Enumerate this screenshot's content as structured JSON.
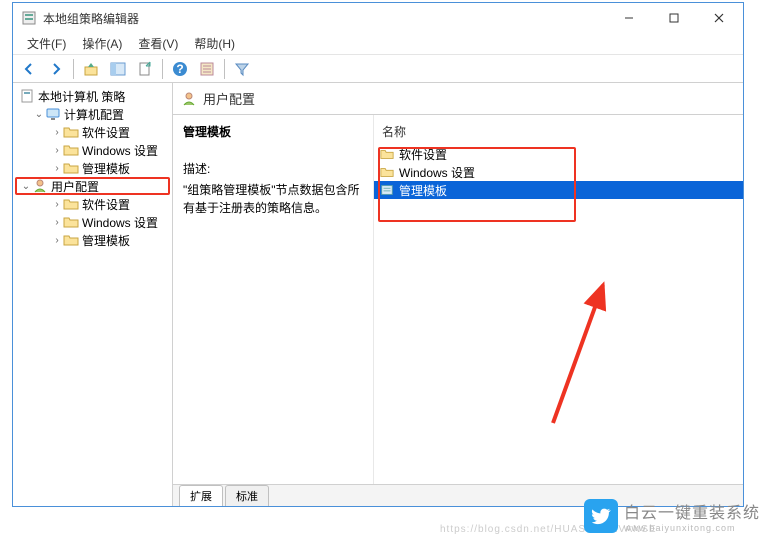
{
  "window": {
    "title": "本地组策略编辑器"
  },
  "menubar": {
    "file": "文件(F)",
    "action": "操作(A)",
    "view": "查看(V)",
    "help": "帮助(H)"
  },
  "tree": {
    "root": "本地计算机 策略",
    "computer_config": "计算机配置",
    "cc_software": "软件设置",
    "cc_windows": "Windows 设置",
    "cc_templates": "管理模板",
    "user_config": "用户配置",
    "uc_software": "软件设置",
    "uc_windows": "Windows 设置",
    "uc_templates": "管理模板"
  },
  "content": {
    "header": "用户配置",
    "section_name": "管理模板",
    "list_header": "名称",
    "desc_label": "描述:",
    "desc_text": "\"组策略管理模板\"节点数据包含所有基于注册表的策略信息。",
    "items": {
      "software": "软件设置",
      "windows": "Windows 设置",
      "templates": "管理模板"
    }
  },
  "tabs": {
    "extended": "扩展",
    "standard": "标准"
  },
  "watermark": {
    "text": "白云一键重装系统",
    "url": "www.baiyunxitong.com",
    "faint": "https://blog.csdn.net/HUASHUDEVANSE"
  }
}
